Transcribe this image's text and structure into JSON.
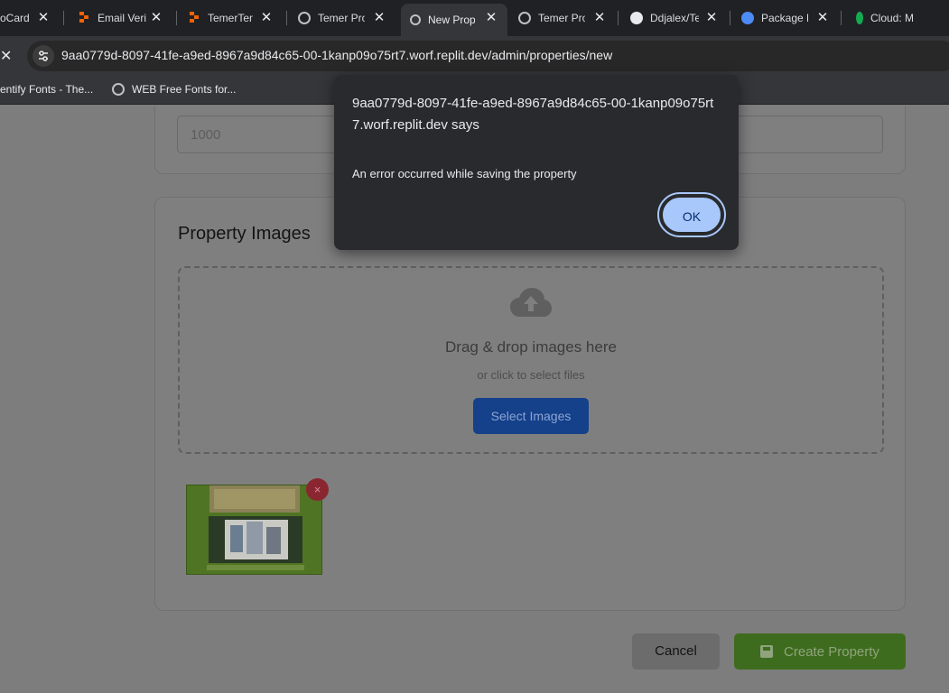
{
  "tabs": [
    {
      "title": "oCard",
      "icon": "none",
      "active": false
    },
    {
      "title": "Email Veri",
      "icon": "replit-icon",
      "active": false
    },
    {
      "title": "TemerTem",
      "icon": "replit-icon",
      "active": false
    },
    {
      "title": "Temer Pro",
      "icon": "globe-icon",
      "active": false
    },
    {
      "title": "New Prop",
      "icon": "globe-icon",
      "active": true
    },
    {
      "title": "Temer Pro",
      "icon": "globe-icon",
      "active": false
    },
    {
      "title": "Ddjalex/Te",
      "icon": "github-icon",
      "active": false
    },
    {
      "title": "Package D",
      "icon": "globe-icon",
      "active": false
    },
    {
      "title": "Cloud: M",
      "icon": "leaf-icon",
      "active": false
    }
  ],
  "address_bar": {
    "url": "9aa0779d-8097-41fe-a9ed-8967a9d84c65-00-1kanp09o75rt7.worf.replit.dev/admin/properties/new"
  },
  "bookmarks": [
    {
      "label": "entify Fonts - The..."
    },
    {
      "label": "WEB Free Fonts for..."
    }
  ],
  "form": {
    "price_value": "1000",
    "images_section_title": "Property Images",
    "dropzone_title": "Drag & drop images here",
    "dropzone_subtitle": "or click to select files",
    "select_button": "Select Images",
    "remove_button": "×",
    "cancel_button": "Cancel",
    "create_button": "Create Property"
  },
  "alert": {
    "origin": "9aa0779d-8097-41fe-a9ed-8967a9d84c65-00-1kanp09o75rt7.worf.replit.dev says",
    "message": "An error occurred while saving the property",
    "ok_button": "OK"
  },
  "colors": {
    "accent_blue": "#a8c7fa",
    "create_green": "#3e6c1e",
    "select_blue": "#15408a"
  }
}
